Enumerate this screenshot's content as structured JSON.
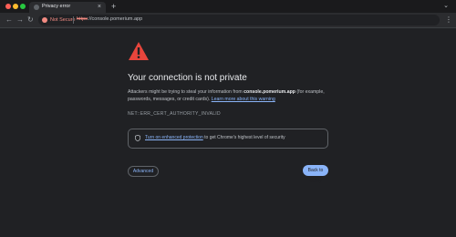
{
  "window": {
    "tab_title": "Privacy error",
    "tab_close": "×",
    "new_tab": "+",
    "controls": "⌄"
  },
  "toolbar": {
    "back": "←",
    "forward": "→",
    "reload": "↻",
    "not_secure_label": "Not Secure",
    "url_scheme": "https",
    "url_rest": "://console.pomerium.app",
    "menu": "⋮"
  },
  "interstitial": {
    "heading": "Your connection is not private",
    "body_prefix": "Attackers might be trying to steal your information from ",
    "domain": "console.pomerium.app",
    "body_suffix": " (for example, passwords, messages, or credit cards). ",
    "learn_more": "Learn more about this warning",
    "error_code": "NET::ERR_CERT_AUTHORITY_INVALID",
    "protection_link": "Turn on enhanced protection",
    "protection_text": " to get Chrome's highest level of security",
    "advanced_label": "Advanced",
    "back_label": "Back to safety"
  },
  "colors": {
    "background": "#202124",
    "warning_red": "#e8453c",
    "link_blue": "#8ab4f8"
  }
}
